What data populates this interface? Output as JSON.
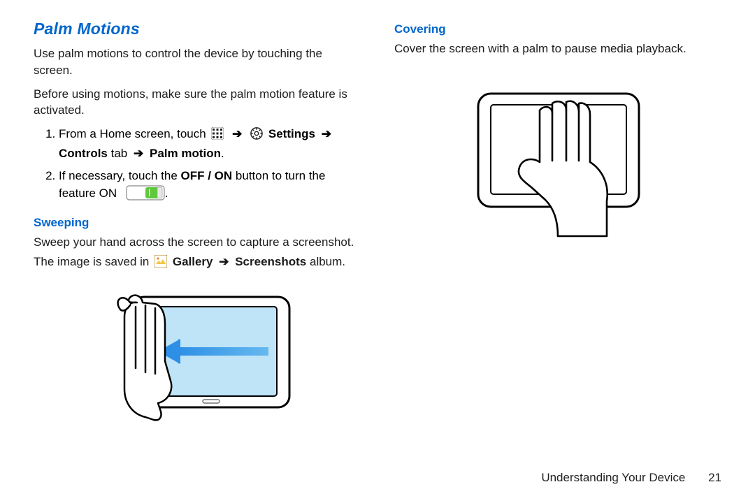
{
  "heading": "Palm Motions",
  "intro1": "Use palm motions to control the device by touching the screen.",
  "intro2": "Before using motions, make sure the palm motion feature is activated.",
  "step1": {
    "pre": "From a Home screen, touch",
    "icon_apps": "apps-icon",
    "icon_settings": "settings-icon",
    "settings_label": "Settings",
    "controls_label": "Controls",
    "tab_word": "tab",
    "palm_motion_label": "Palm motion",
    "period": "."
  },
  "step2": {
    "pre": "If necessary, touch the",
    "off_on": "OFF / ON",
    "post": "button to turn the feature ON"
  },
  "sweeping": {
    "title": "Sweeping",
    "line1": "Sweep your hand across the screen to capture a screenshot.",
    "line2a": "The image is saved in",
    "gallery": "Gallery",
    "screenshots": "Screenshots",
    "album_word": "album."
  },
  "covering": {
    "title": "Covering",
    "text": "Cover the screen with a palm to pause media playback."
  },
  "footer": {
    "section": "Understanding Your Device",
    "page": "21"
  }
}
